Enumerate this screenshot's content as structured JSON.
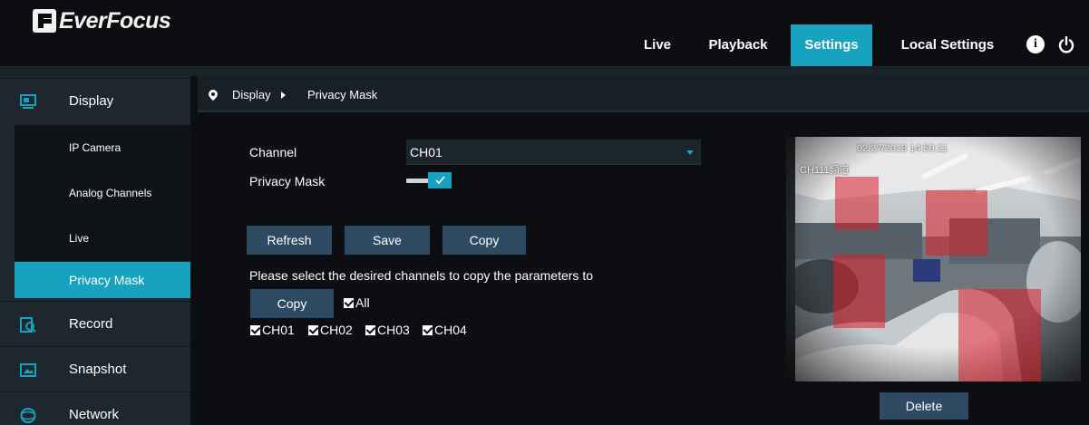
{
  "brand": {
    "name": "EverFocus"
  },
  "header": {
    "nav": [
      "Live",
      "Playback",
      "Settings",
      "Local Settings"
    ],
    "active": "Settings",
    "icons": {
      "info": "info-icon",
      "power": "power-icon"
    }
  },
  "sidebar": {
    "sections": [
      {
        "label": "Display",
        "icon": "display-icon"
      },
      {
        "label": "Record",
        "icon": "record-icon"
      },
      {
        "label": "Snapshot",
        "icon": "snapshot-icon"
      },
      {
        "label": "Network",
        "icon": "network-icon"
      }
    ],
    "display_items": [
      "IP Camera",
      "Analog Channels",
      "Live",
      "Privacy Mask"
    ],
    "active_item": "Privacy Mask"
  },
  "breadcrumb": {
    "root": "Display",
    "current": "Privacy Mask"
  },
  "form": {
    "channel_label": "Channel",
    "channel_value": "CH01",
    "privacy_mask_label": "Privacy Mask",
    "privacy_mask_enabled": true,
    "buttons": {
      "refresh": "Refresh",
      "save": "Save",
      "copy": "Copy"
    },
    "copy_hint": "Please select the desired channels to copy the parameters to",
    "copy_button": "Copy",
    "all_label": "All",
    "channels": [
      "CH01",
      "CH02",
      "CH03",
      "CH04"
    ]
  },
  "preview": {
    "timestamp": "02/27/2018 14:50:11",
    "channel_osd": "CH111頻道",
    "delete_button": "Delete"
  },
  "colors": {
    "accent": "#17a3bf",
    "button": "#2e4a62",
    "sidebar": "#1e272e",
    "mask": "#dc1e28"
  }
}
